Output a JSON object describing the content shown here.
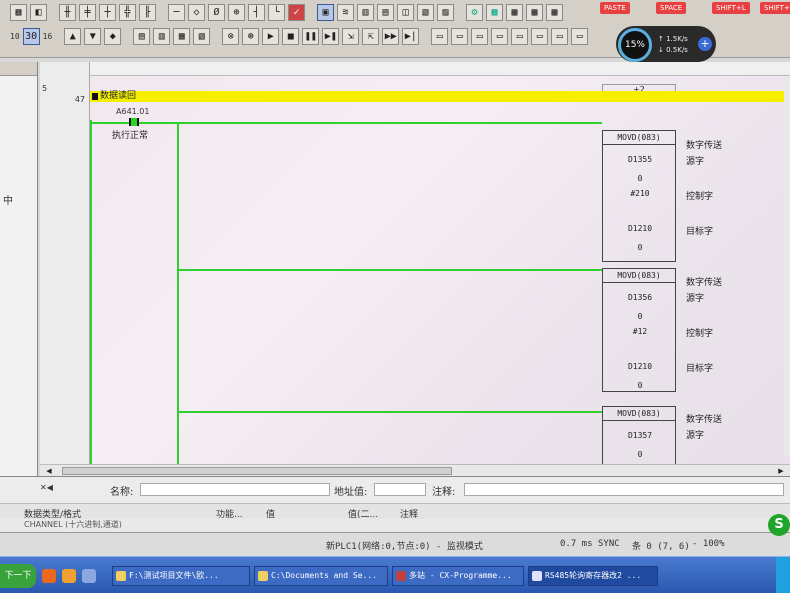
{
  "toolbar": {
    "row1_texts": [
      "10",
      "30",
      "16"
    ],
    "red_buttons": [
      "PASTE",
      "SPACE",
      "SHIFT+L",
      "SHIFT+"
    ]
  },
  "speed_widget": {
    "percent": "15%",
    "upload": "1.5K/s",
    "download": "0.5K/s",
    "count": "0"
  },
  "left_pane": {
    "label": "中"
  },
  "ladder": {
    "rung_number": "5",
    "step_number": "47",
    "top_cell": "+2",
    "comment": "数据读回",
    "contact_address": "A641.01",
    "contact_comment": "执行正常",
    "blocks": [
      {
        "instr": "MOVD(083)",
        "src": "D1355",
        "src_val": "0",
        "ctrl": "#210",
        "dst": "D1210",
        "dst_val": "0",
        "label_instr": "数字传送",
        "label_src": "源字",
        "label_ctrl": "控制字",
        "label_dst": "目标字"
      },
      {
        "instr": "MOVD(083)",
        "src": "D1356",
        "src_val": "0",
        "ctrl": "#12",
        "dst": "D1210",
        "dst_val": "0",
        "label_instr": "数字传送",
        "label_src": "源字",
        "label_ctrl": "控制字",
        "label_dst": "目标字"
      },
      {
        "instr": "MOVD(083)",
        "src": "D1357",
        "src_val": "0",
        "label_instr": "数字传送",
        "label_src": "源字"
      }
    ]
  },
  "watch": {
    "name_label": "名称:",
    "address_label": "地址值:",
    "comment_label": "注释:",
    "columns": [
      "数据类型/格式",
      "功能...",
      "值",
      "值(二...",
      "注释"
    ],
    "row_partial": "CHANNEL (十六进制,通道)"
  },
  "status": {
    "plc": "新PLC1(网络:0,节点:0) - 监视模式",
    "scan": "0.7 ms",
    "sync": "SYNC",
    "rung": "条 0 (7, 6)",
    "zoom": "- 100%"
  },
  "taskbar": {
    "start": "下一下",
    "tasks": [
      "F:\\测试项目文件\\欧...",
      "C:\\Documents and Se...",
      "多站 - CX-Programme...",
      "RS485轮询寄存器改2 ..."
    ]
  },
  "sogou": "S"
}
